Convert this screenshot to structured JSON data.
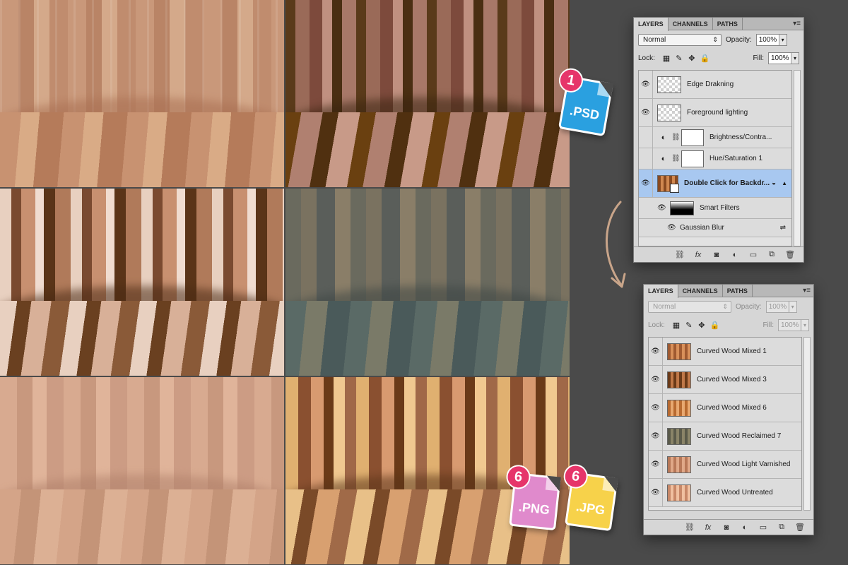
{
  "thumbnails": [
    {
      "id": "w1"
    },
    {
      "id": "w2"
    },
    {
      "id": "w3"
    },
    {
      "id": "w4"
    },
    {
      "id": "w5"
    },
    {
      "id": "w6"
    }
  ],
  "badges": {
    "psd": {
      "number": "1",
      "ext": ".PSD",
      "color": "#2aa0e0"
    },
    "png": {
      "number": "6",
      "ext": ".PNG",
      "color": "#e08acc"
    },
    "jpg": {
      "number": "6",
      "ext": ".JPG",
      "color": "#f7d24a"
    }
  },
  "panel1": {
    "tabs": [
      "LAYERS",
      "CHANNELS",
      "PATHS"
    ],
    "blend_mode": "Normal",
    "opacity_label": "Opacity:",
    "opacity_value": "100%",
    "lock_label": "Lock:",
    "fill_label": "Fill:",
    "fill_value": "100%",
    "layers": [
      {
        "name": "Edge Drakning",
        "visible": true
      },
      {
        "name": "Foreground lighting",
        "visible": true
      },
      {
        "name": "Brightness/Contra...",
        "visible": false
      },
      {
        "name": "Hue/Saturation 1",
        "visible": false
      },
      {
        "name": "Double Click for Backdr...",
        "visible": true,
        "selected": true
      },
      {
        "name": "Smart Filters",
        "visible": true
      },
      {
        "name": "Gaussian Blur",
        "visible": true
      }
    ]
  },
  "panel2": {
    "tabs": [
      "LAYERS",
      "CHANNELS",
      "PATHS"
    ],
    "blend_mode": "Normal",
    "opacity_label": "Opacity:",
    "opacity_value": "100%",
    "lock_label": "Lock:",
    "fill_label": "Fill:",
    "fill_value": "100%",
    "layers": [
      {
        "name": "Curved Wood Mixed 1",
        "visible": true
      },
      {
        "name": "Curved Wood Mixed 3",
        "visible": true
      },
      {
        "name": "Curved Wood Mixed 6",
        "visible": true
      },
      {
        "name": "Curved Wood Reclaimed 7",
        "visible": true
      },
      {
        "name": "Curved Wood Light Varnished",
        "visible": true
      },
      {
        "name": "Curved Wood Untreated",
        "visible": true
      }
    ]
  },
  "icons": {
    "eye": "eye-icon",
    "link": "link-icon",
    "fx": "fx-icon",
    "mask": "mask-icon",
    "adjustment": "adjustment-icon",
    "folder": "folder-icon",
    "new_layer": "new-layer-icon",
    "trash": "trash-icon"
  }
}
